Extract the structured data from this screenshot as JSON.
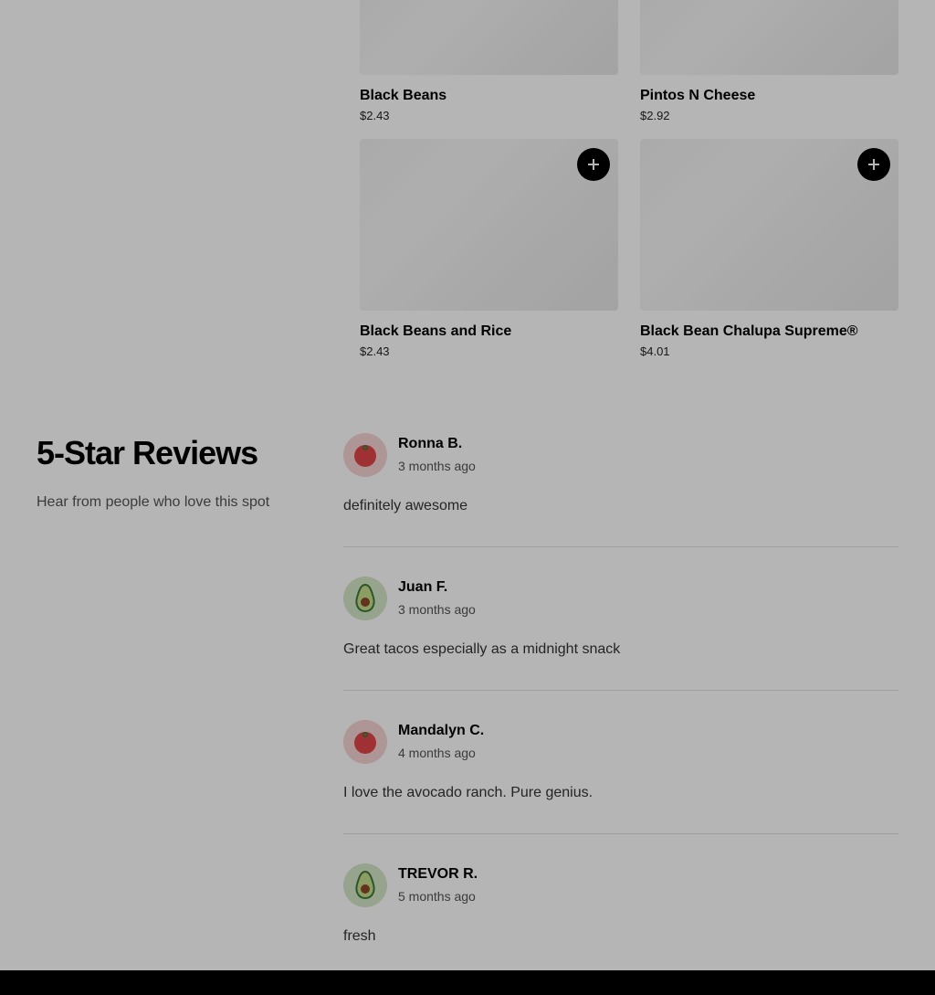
{
  "menu_items": [
    {
      "name": "Black Beans",
      "price": "$2.43"
    },
    {
      "name": "Pintos N Cheese",
      "price": "$2.92"
    },
    {
      "name": "Black Beans and Rice",
      "price": "$2.43"
    },
    {
      "name": "Black Bean Chalupa Supreme®",
      "price": "$4.01"
    }
  ],
  "reviews_section": {
    "title": "5-Star Reviews",
    "subtitle": "Hear from people who love this spot"
  },
  "reviews": [
    {
      "author": "Ronna B.",
      "time": "3 months ago",
      "text": "definitely awesome",
      "avatar_icon": "tomato-icon"
    },
    {
      "author": "Juan F.",
      "time": "3 months ago",
      "text": "Great tacos especially as a midnight snack",
      "avatar_icon": "avocado-icon"
    },
    {
      "author": "Mandalyn C.",
      "time": "4 months ago",
      "text": "I love the avocado ranch. Pure genius.",
      "avatar_icon": "tomato-icon"
    },
    {
      "author": "TREVOR R.",
      "time": "5 months ago",
      "text": "fresh",
      "avatar_icon": "avocado-icon"
    }
  ],
  "colors": {
    "overlay": "#000000",
    "add_button": "#000000",
    "tomato_avatar_bg": "#f7d3d3",
    "avocado_avatar_bg": "#d3e8c8"
  }
}
